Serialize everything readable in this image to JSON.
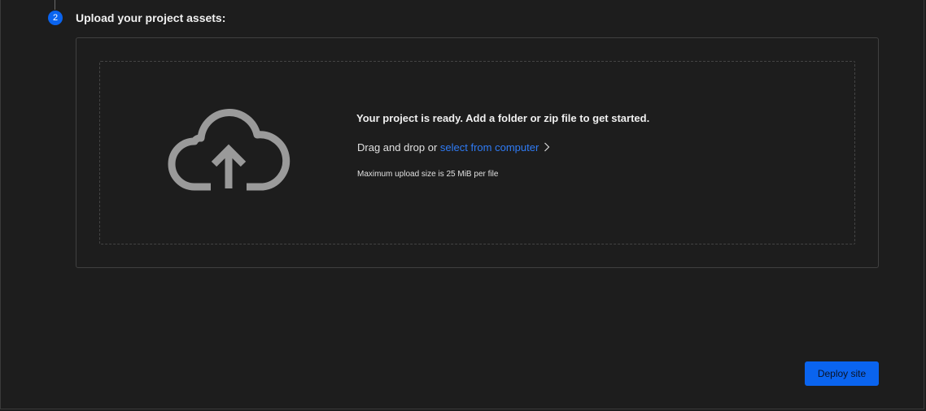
{
  "step": {
    "number": "2",
    "title": "Upload your project assets:"
  },
  "upload": {
    "icon": "cloud-upload-icon",
    "ready_message": "Your project is ready. Add a folder or zip file to get started.",
    "drag_text": "Drag and drop or ",
    "select_link": "select from computer",
    "max_size_note": "Maximum upload size is 25 MiB per file"
  },
  "actions": {
    "deploy_label": "Deploy site"
  },
  "colors": {
    "background": "#1d1d1d",
    "accent": "#0a64ef",
    "link": "#2f7bf5",
    "icon": "#9a9a9a"
  }
}
